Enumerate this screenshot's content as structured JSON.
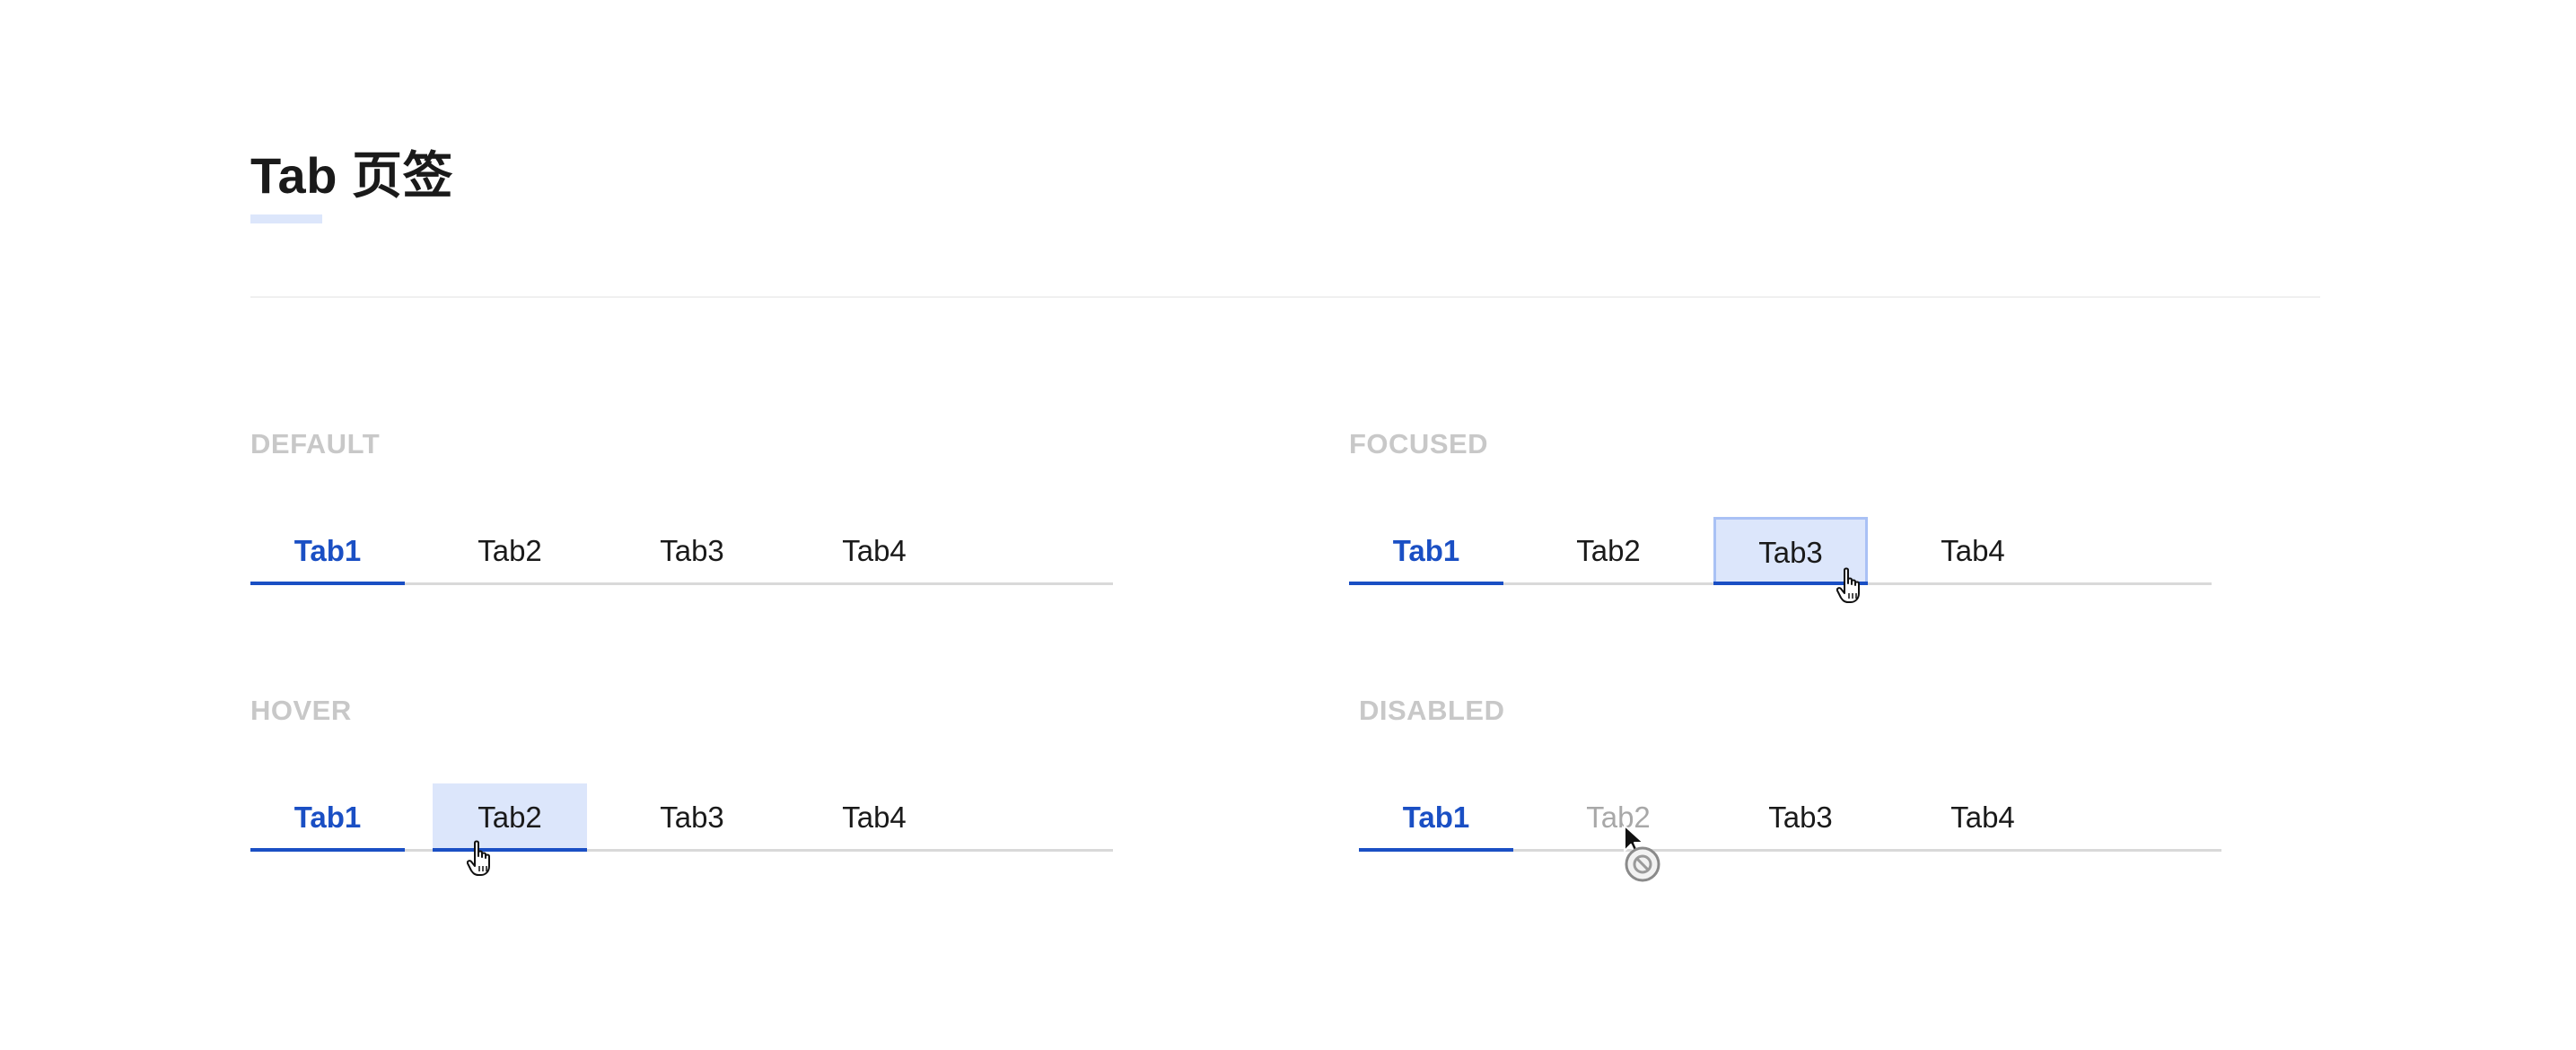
{
  "page": {
    "title": "Tab 页签"
  },
  "sections": {
    "default": {
      "label": "DEFAULT",
      "tabs": [
        "Tab1",
        "Tab2",
        "Tab3",
        "Tab4"
      ]
    },
    "focused": {
      "label": "FOCUSED",
      "tabs": [
        "Tab1",
        "Tab2",
        "Tab3",
        "Tab4"
      ]
    },
    "hover": {
      "label": "HOVER",
      "tabs": [
        "Tab1",
        "Tab2",
        "Tab3",
        "Tab4"
      ]
    },
    "disabled": {
      "label": "DISABLED",
      "tabs": [
        "Tab1",
        "Tab2",
        "Tab3",
        "Tab4"
      ]
    }
  },
  "colors": {
    "accent": "#1a4fc4",
    "highlight": "#dce6fb",
    "focus_border": "#a9c1f5",
    "label_gray": "#c8c8c8",
    "disabled_text": "#a8a8a8",
    "baseline": "#d9d9d9"
  },
  "icons": {
    "hand_cursor": "hand-pointer-cursor-icon",
    "arrow_cursor": "arrow-cursor-icon",
    "not_allowed": "not-allowed-icon"
  }
}
